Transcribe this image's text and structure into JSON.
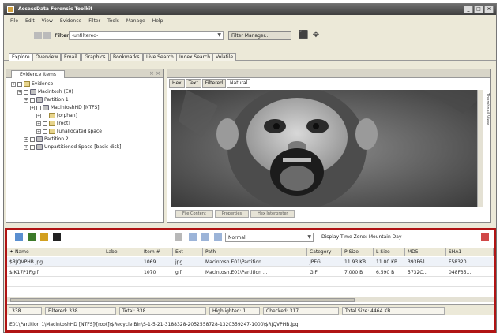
{
  "window": {
    "title": "AccessData Forensic Toolkit"
  },
  "menu": [
    "File",
    "Edit",
    "View",
    "Evidence",
    "Filter",
    "Tools",
    "Manage",
    "Help"
  ],
  "filter": {
    "label": "Filter:",
    "value": "-unfiltered-",
    "manager_label": "Filter Manager..."
  },
  "tabs": [
    "Explore",
    "Overview",
    "Email",
    "Graphics",
    "Bookmarks",
    "Live Search",
    "Index Search",
    "Volatile"
  ],
  "evidence_panel": {
    "title": "Evidence Items",
    "tree": [
      {
        "label": "Evidence",
        "level": 0,
        "icon": "folder"
      },
      {
        "label": "Macintosh (E0)",
        "level": 1,
        "icon": "disk"
      },
      {
        "label": "Partition 1",
        "level": 2,
        "icon": "disk"
      },
      {
        "label": "MacintoshHD [NTFS]",
        "level": 3,
        "icon": "disk"
      },
      {
        "label": "[orphan]",
        "level": 4,
        "icon": "folder"
      },
      {
        "label": "[root]",
        "level": 4,
        "icon": "folder"
      },
      {
        "label": "[unallocated space]",
        "level": 4,
        "icon": "folder"
      },
      {
        "label": "Partition 2",
        "level": 2,
        "icon": "disk"
      },
      {
        "label": "Unpartitioned Space [basic disk]",
        "level": 2,
        "icon": "disk"
      }
    ]
  },
  "viewer": {
    "tabs": [
      "Hex",
      "Text",
      "Filtered",
      "Natural"
    ],
    "active_tab": "Natural",
    "bottom_tabs": [
      "File Content",
      "Properties",
      "Hex Interpreter"
    ],
    "side_tabs": "Thumbnail View"
  },
  "filelist": {
    "display_mode": "Normal",
    "timezone": "Display Time Zone: Mountain Day",
    "columns": [
      "Name",
      "Label",
      "Item #",
      "Ext",
      "Path",
      "Category",
      "P-Size",
      "L-Size",
      "MD5",
      "SHA1"
    ],
    "rows": [
      [
        "$RJQVPHB.jpg",
        "",
        "1069",
        "jpg",
        "Macintosh.E01\\Partition ...",
        "JPEG",
        "11.93 KB",
        "11.00 KB",
        "393F61...",
        "F58320..."
      ],
      [
        "$IK17P1F.gif",
        "",
        "1070",
        "gif",
        "Macintosh.E01\\Partition ...",
        "GIF",
        "7.000 B",
        "6.590 B",
        "5732C...",
        "048F35..."
      ],
      [
        "",
        "",
        "",
        "",
        "",
        "",
        "",
        "",
        "",
        ""
      ]
    ]
  },
  "status": {
    "total": "338",
    "filtered": "Filtered: 338",
    "total_label": "Total: 338",
    "highlighted": "Highlighted: 1",
    "checked": "Checked: 317",
    "total_size": "Total Size: 4464 KB"
  },
  "path": "E01\\Partition 1\\MacintoshHD [NTFS]\\[root]\\$Recycle.Bin\\S-1-5-21-3188328-2052558728-1320359247-1000\\$RJQVPHB.jpg"
}
